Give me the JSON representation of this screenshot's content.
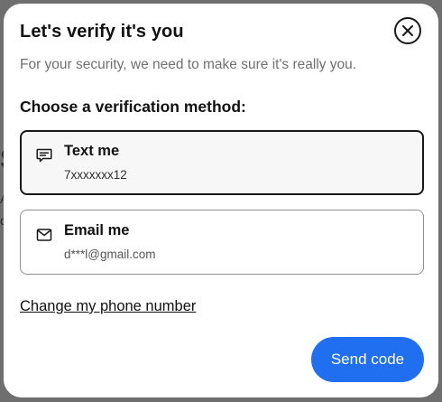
{
  "dialog": {
    "title": "Let's verify it's you",
    "subtitle": "For your security, we need to make sure it's really you.",
    "section_label": "Choose a verification method:",
    "options": [
      {
        "label": "Text me",
        "value": "7xxxxxxx12",
        "icon": "chat-bubble-icon",
        "selected": true
      },
      {
        "label": "Email me",
        "value": "d***l@gmail.com",
        "icon": "envelope-icon",
        "selected": false
      }
    ],
    "change_link": "Change my phone number",
    "send_button": "Send code",
    "close_icon": "close-icon"
  },
  "background": {
    "fragments": [
      "S",
      "A",
      "c"
    ]
  },
  "colors": {
    "accent": "#1f6ff0",
    "overlay": "#6f6f6f",
    "text": "#111111",
    "muted": "#707070"
  }
}
